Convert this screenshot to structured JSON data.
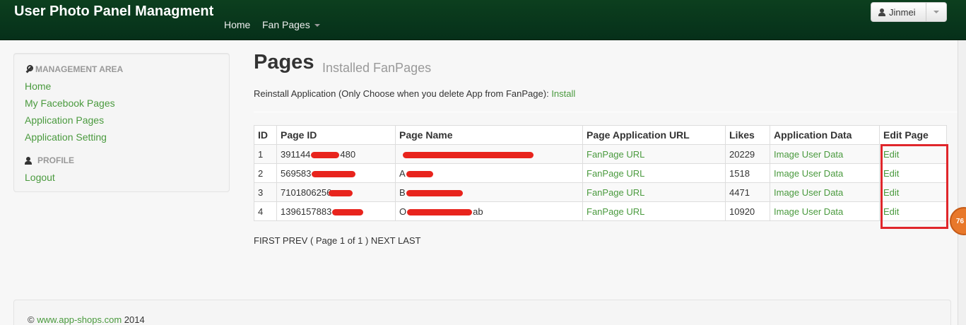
{
  "navbar": {
    "brand": "User Photo Panel Managment",
    "links": [
      "Home",
      "Fan Pages"
    ],
    "user": "Jinmei"
  },
  "sidebar": {
    "management_header": "MANAGEMENT AREA",
    "management_items": [
      "Home",
      "My Facebook Pages",
      "Application Pages",
      "Application Setting"
    ],
    "profile_header": "PROFILE",
    "profile_items": [
      "Logout"
    ]
  },
  "main": {
    "title": "Pages",
    "subtitle": "Installed FanPages",
    "reinstall_text": "Reinstall Application (Only Choose when you delete App from FanPage):",
    "reinstall_link": "Install",
    "table": {
      "headers": [
        "ID",
        "Page ID",
        "Page Name",
        "Page Application URL",
        "Likes",
        "Application Data",
        "Edit Page"
      ],
      "rows": [
        {
          "id": "1",
          "page_id": "391144",
          "page_id_tail": "480",
          "page_name": "",
          "url": "FanPage URL",
          "likes": "20229",
          "data": "Image User Data",
          "edit": "Edit"
        },
        {
          "id": "2",
          "page_id": "569583",
          "page_id_tail": "",
          "page_name": "A",
          "url": "FanPage URL",
          "likes": "1518",
          "data": "Image User Data",
          "edit": "Edit"
        },
        {
          "id": "3",
          "page_id": "7101806256",
          "page_id_tail": "",
          "page_name": "B",
          "url": "FanPage URL",
          "likes": "4471",
          "data": "Image User Data",
          "edit": "Edit"
        },
        {
          "id": "4",
          "page_id": "1396157883",
          "page_id_tail": "",
          "page_name": "O",
          "page_name_tail": "ab",
          "url": "FanPage URL",
          "likes": "10920",
          "data": "Image User Data",
          "edit": "Edit"
        }
      ]
    },
    "pager": "FIRST PREV ( Page 1 of 1 ) NEXT LAST"
  },
  "badge": "76",
  "footer": {
    "prefix": "©",
    "link": "www.app-shops.com",
    "year": "2014"
  },
  "colors": {
    "navbar": "#0c3f1e",
    "link": "#4a9a3e",
    "highlight": "#e0262b",
    "redaction": "#e8241d"
  }
}
